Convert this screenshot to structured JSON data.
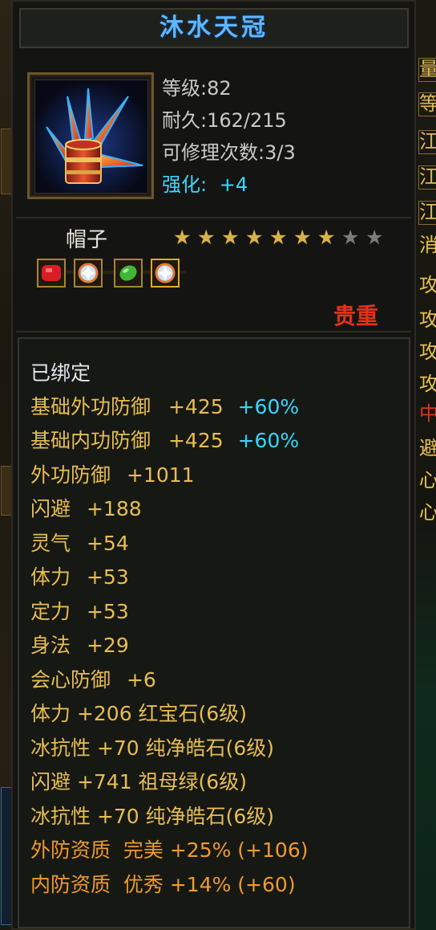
{
  "item": {
    "name": "沐水天冠",
    "level": "等级:82",
    "durability": "耐久:162/215",
    "repairs": "可修理次数:3/3",
    "enhance_label": "强化:",
    "enhance_value": "+4",
    "type": "帽子",
    "stars": {
      "filled": 7,
      "total": 9
    },
    "rarity": "贵重",
    "bound": "已绑定"
  },
  "attributes": [
    {
      "name": "基础外功防御",
      "value": "+425",
      "extra": "+60%"
    },
    {
      "name": "基础内功防御",
      "value": "+425",
      "extra": "+60%"
    },
    {
      "name": "外功防御",
      "value": "+1011"
    },
    {
      "name": "闪避",
      "value": "+188"
    },
    {
      "name": "灵气",
      "value": "+54"
    },
    {
      "name": "体力",
      "value": "+53"
    },
    {
      "name": "定力",
      "value": "+53"
    },
    {
      "name": "身法",
      "value": "+29"
    },
    {
      "name": "会心防御",
      "value": "+6"
    }
  ],
  "gem_attributes": [
    {
      "text": "体力 +206 红宝石(6级)"
    },
    {
      "text": "冰抗性 +70 纯净皓石(6级)"
    },
    {
      "text": "闪避 +741 祖母绿(6级)"
    },
    {
      "text": "冰抗性 +70 纯净皓石(6级)"
    }
  ],
  "quality": [
    {
      "text": "外防资质  完美 +25% (+106)"
    },
    {
      "text": "内防资质  优秀 +14% (+60)"
    }
  ],
  "gems": [
    {
      "icon": "red-gem-icon",
      "color": "#d81d24"
    },
    {
      "icon": "white-gem-icon",
      "color": "#cfe2f3"
    },
    {
      "icon": "green-gem-icon",
      "color": "#3fb83a"
    },
    {
      "icon": "white-gem-icon",
      "color": "#cfe2f3"
    }
  ],
  "colors": {
    "title": "#5fb6ff",
    "enhance": "#3bd7ff",
    "attribute": "#e7bd52",
    "quality": "#ef9a2c",
    "rarity": "#e0321e"
  },
  "side_peek": [
    "量",
    "等",
    "江",
    "江",
    "江",
    "消",
    "攻",
    "攻",
    "攻",
    "攻",
    "中",
    "避",
    "心",
    "心"
  ]
}
